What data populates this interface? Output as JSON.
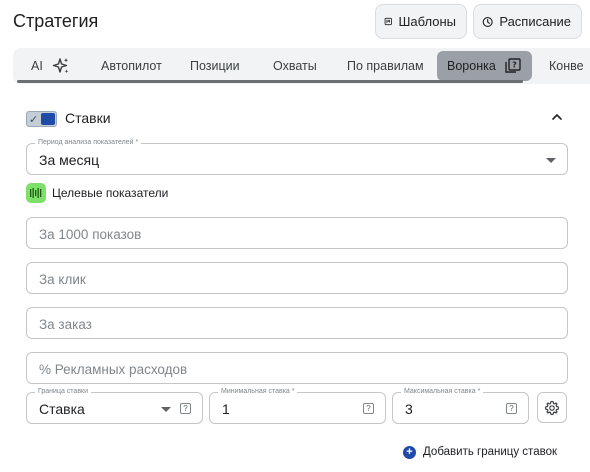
{
  "header": {
    "title": "Стратегия",
    "templates_label": "Шаблоны",
    "schedule_label": "Расписание"
  },
  "tabs": [
    {
      "label": "AI",
      "icon": "sparkle-icon"
    },
    {
      "label": "Автопилот"
    },
    {
      "label": "Позиции"
    },
    {
      "label": "Охваты"
    },
    {
      "label": "По правилам"
    },
    {
      "label": "Воронка",
      "icon": "help-stack-icon",
      "active": true
    },
    {
      "label": "Конве"
    }
  ],
  "section": {
    "title": "Ставки",
    "enabled": true,
    "period": {
      "label": "Период анализа показателей *",
      "value": "За месяц"
    },
    "targets_label": "Целевые показатели",
    "inputs": [
      {
        "placeholder": "За 1000 показов"
      },
      {
        "placeholder": "За клик"
      },
      {
        "placeholder": "За заказ"
      },
      {
        "placeholder": "% Рекламных расходов"
      }
    ],
    "bid_bounds": {
      "type": {
        "label": "Граница ставки",
        "value": "Ставка"
      },
      "min": {
        "label": "Минимальная ставка *",
        "value": "1"
      },
      "max": {
        "label": "Максимальная ставка *",
        "value": "3"
      }
    },
    "add_bound_label": "Добавить границу ставок"
  },
  "colors": {
    "accent": "#1f4aa8",
    "targets_badge": "#7ee06a",
    "active_tab": "#9aa0a6"
  }
}
